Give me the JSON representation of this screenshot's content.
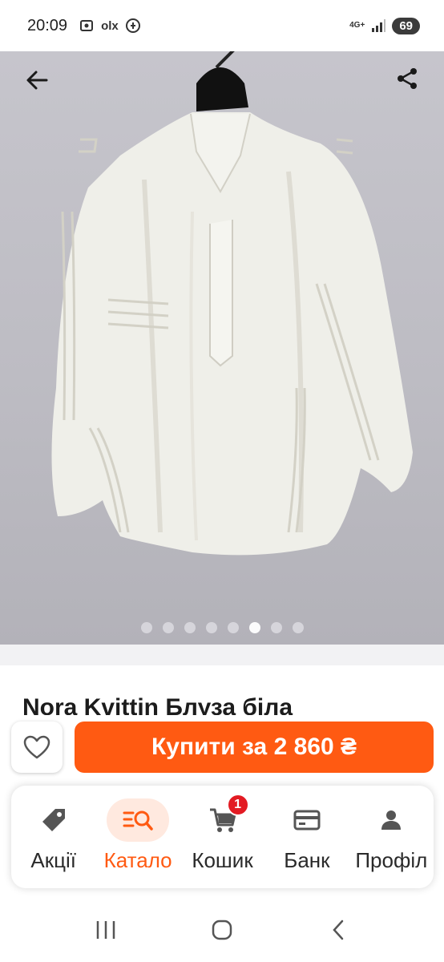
{
  "status_bar": {
    "time": "20:09",
    "app_icons": [
      "screenshot-icon",
      "olx-icon",
      "gift-icon"
    ],
    "olx_text": "olx",
    "network": "4G+",
    "battery": "69"
  },
  "gallery": {
    "image_count": 8,
    "active_index": 5
  },
  "product": {
    "title": "Nora Kvittin Блуза біла"
  },
  "buy": {
    "label": "Купити за 2 860 ₴"
  },
  "tabs": [
    {
      "label": "Акції",
      "icon": "tag-icon"
    },
    {
      "label": "Катало",
      "icon": "catalog-search-icon"
    },
    {
      "label": "Кошик",
      "icon": "cart-icon",
      "badge": "1"
    },
    {
      "label": "Банк",
      "icon": "bank-card-icon"
    },
    {
      "label": "Профіл",
      "icon": "profile-icon"
    }
  ],
  "colors": {
    "accent": "#ff5a12",
    "badge": "#e31b23"
  }
}
